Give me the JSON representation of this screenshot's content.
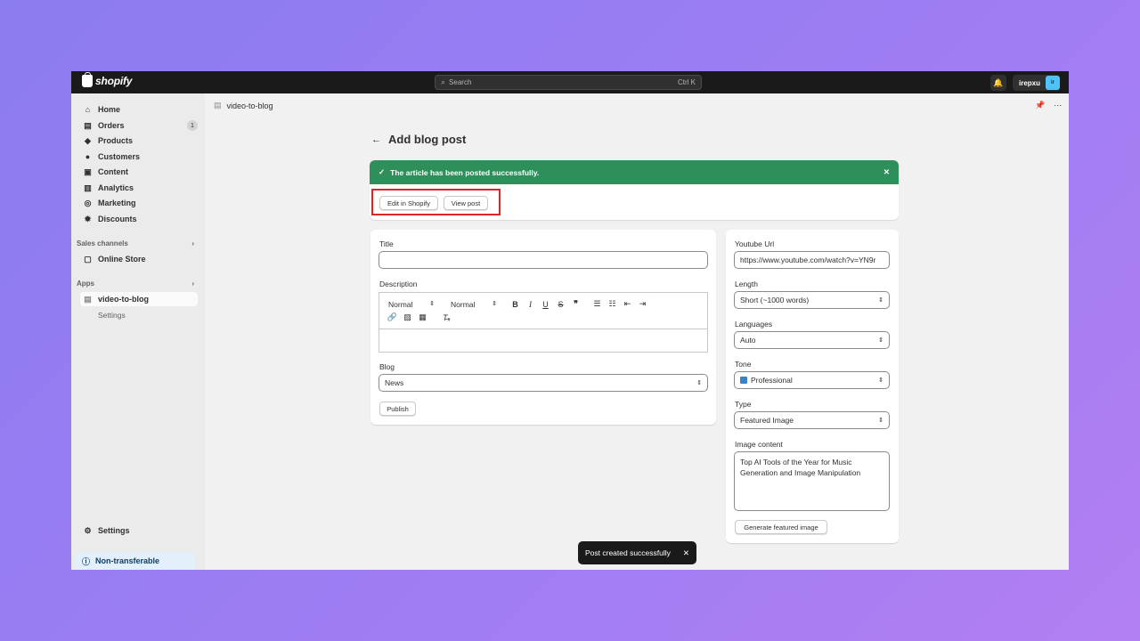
{
  "topbar": {
    "logo": "shopify",
    "search_placeholder": "Search",
    "search_shortcut": "Ctrl K",
    "user_name": "irepxu",
    "user_avatar": "ir"
  },
  "sidebar": {
    "items": [
      {
        "label": "Home",
        "icon": "home-icon"
      },
      {
        "label": "Orders",
        "icon": "orders-icon",
        "badge": "1"
      },
      {
        "label": "Products",
        "icon": "tag-icon"
      },
      {
        "label": "Customers",
        "icon": "person-icon"
      },
      {
        "label": "Content",
        "icon": "content-icon"
      },
      {
        "label": "Analytics",
        "icon": "chart-icon"
      },
      {
        "label": "Marketing",
        "icon": "target-icon"
      },
      {
        "label": "Discounts",
        "icon": "discount-icon"
      }
    ],
    "sales_channels_label": "Sales channels",
    "online_store": "Online Store",
    "apps_label": "Apps",
    "app_name": "video-to-blog",
    "app_settings": "Settings",
    "settings": "Settings",
    "non_transferable": "Non-transferable"
  },
  "breadcrumb": "video-to-blog",
  "page": {
    "title": "Add blog post",
    "banner_message": "The article has been posted successfully.",
    "edit_button": "Edit in Shopify",
    "view_button": "View post"
  },
  "form": {
    "title_label": "Title",
    "title_value": "",
    "description_label": "Description",
    "heading_select": "Normal",
    "size_select": "Normal",
    "blog_label": "Blog",
    "blog_value": "News",
    "publish_button": "Publish"
  },
  "settings_panel": {
    "youtube_label": "Youtube Url",
    "youtube_value": "https://www.youtube.com/watch?v=YN9r",
    "length_label": "Length",
    "length_value": "Short (~1000 words)",
    "languages_label": "Languages",
    "languages_value": "Auto",
    "tone_label": "Tone",
    "tone_value": "Professional",
    "type_label": "Type",
    "type_value": "Featured Image",
    "image_content_label": "Image content",
    "image_content_value": "Top AI Tools of the Year for Music Generation and Image Manipulation",
    "generate_button": "Generate featured image"
  },
  "toast": "Post created successfully",
  "colors": {
    "success_banner": "#2f8f5b",
    "highlight_border": "#e02424",
    "topbar": "#1a1a1a"
  }
}
